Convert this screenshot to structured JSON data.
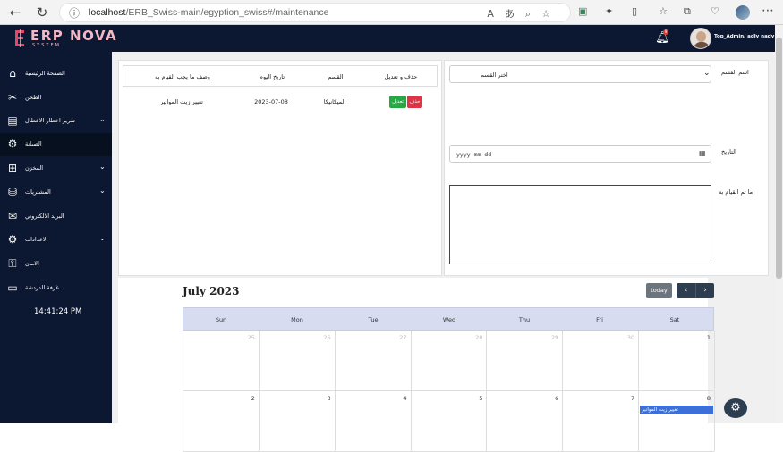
{
  "browser": {
    "url_host": "localhost",
    "url_path": "/ERB_Swiss-main/egyption_swiss#/maintenance",
    "icons": [
      "back-icon",
      "refresh-icon",
      "info-icon",
      "read-aloud-icon",
      "translate-icon",
      "zoom-icon",
      "favorite-icon",
      "extension-icon",
      "split-icon",
      "favorites-icon",
      "collections-icon",
      "performance-icon",
      "profile-icon",
      "more-icon"
    ]
  },
  "header": {
    "logo_text": "ERP NOVA",
    "logo_subtext": "SYSTEM",
    "notification_count": "9",
    "user_name": "Top_Admin/ adly nady"
  },
  "sidebar": {
    "items": [
      {
        "label": "الصفحة الرئيسية",
        "icon": "home-icon"
      },
      {
        "label": "الطحن",
        "icon": "grinder-icon"
      },
      {
        "label": "تقرير اخطار الاعطال",
        "icon": "report-icon"
      },
      {
        "label": "الصيانة",
        "icon": "gear-icon"
      },
      {
        "label": "المخزن",
        "icon": "boxes-icon"
      },
      {
        "label": "المشتريات",
        "icon": "purchases-icon"
      },
      {
        "label": "البريد الالكتروني",
        "icon": "mail-icon"
      },
      {
        "label": "الاعدادات",
        "icon": "settings-icon"
      },
      {
        "label": "الامان",
        "icon": "security-icon"
      },
      {
        "label": "غرفة الدردشة",
        "icon": "chat-icon"
      }
    ],
    "clock": "14:41:24 PM"
  },
  "table": {
    "headers": [
      "حذف و تعديل",
      "القسم",
      "تاريخ اليوم",
      "وصف ما يجب القيام به"
    ],
    "rows": [
      {
        "delete_label": "حذف",
        "edit_label": "تعديل",
        "department": "الميكانيكا",
        "date": "2023-07-08",
        "description": "تغيير زيت المواتير"
      }
    ]
  },
  "form": {
    "department_label": "اسم القسم",
    "department_placeholder": "اختر القسم",
    "date_label": "التاريخ",
    "date_placeholder": "yyyy-mm-dd",
    "done_label": "ما تم القيام به"
  },
  "calendar": {
    "title": "July 2023",
    "today_label": "today",
    "days_of_week": [
      "Sun",
      "Mon",
      "Tue",
      "Wed",
      "Thu",
      "Fri",
      "Sat"
    ],
    "weeks": [
      [
        {
          "n": "25",
          "other": true
        },
        {
          "n": "26",
          "other": true
        },
        {
          "n": "27",
          "other": true
        },
        {
          "n": "28",
          "other": true
        },
        {
          "n": "29",
          "other": true
        },
        {
          "n": "30",
          "other": true
        },
        {
          "n": "1",
          "other": false
        }
      ],
      [
        {
          "n": "2",
          "other": false
        },
        {
          "n": "3",
          "other": false
        },
        {
          "n": "4",
          "other": false
        },
        {
          "n": "5",
          "other": false
        },
        {
          "n": "6",
          "other": false
        },
        {
          "n": "7",
          "other": false
        },
        {
          "n": "8",
          "other": false,
          "event": "تغيير زيت المواتير"
        }
      ]
    ],
    "event_color": "#3d6fd8"
  },
  "colors": {
    "sidebar_bg": "#0c1831",
    "delete": "#dc3545",
    "edit": "#28a745",
    "today_btn": "#6c757d",
    "nav_btn": "#2c3e50"
  }
}
